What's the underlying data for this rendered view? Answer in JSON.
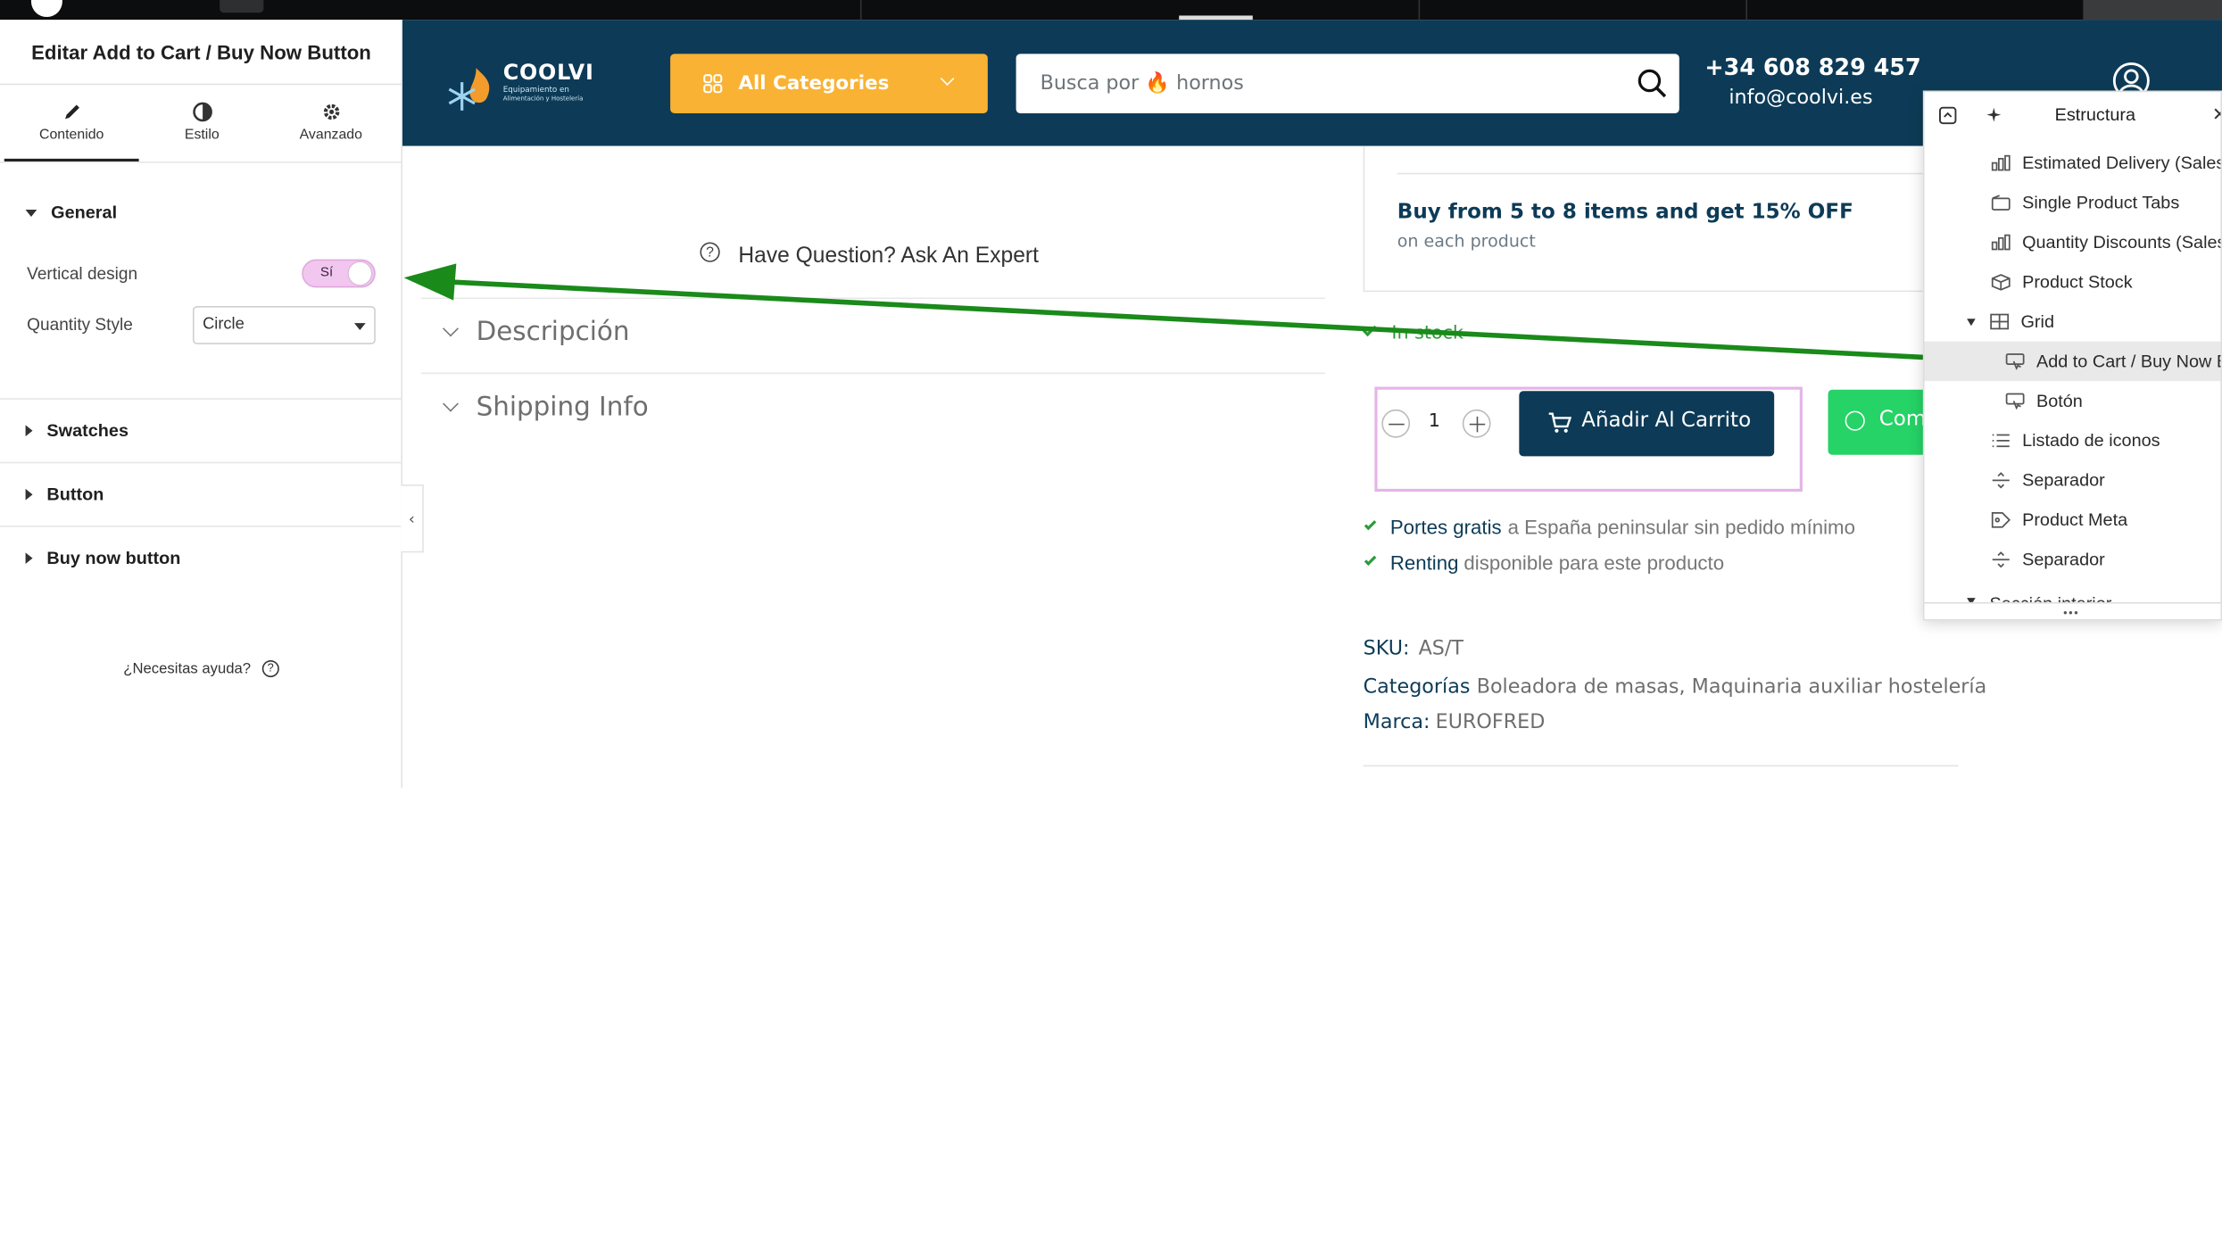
{
  "editor": {
    "title": "Editar Add to Cart / Buy Now Button",
    "tabs": [
      {
        "label": "Contenido",
        "icon": "pencil-icon",
        "active": true
      },
      {
        "label": "Estilo",
        "icon": "half-circle-icon",
        "active": false
      },
      {
        "label": "Avanzado",
        "icon": "gear-icon",
        "active": false
      }
    ],
    "general": {
      "heading": "General",
      "vertical_label": "Vertical design",
      "vertical_value": "Sí",
      "quantity_label": "Quantity Style",
      "quantity_value": "Circle"
    },
    "sections": [
      "Swatches",
      "Button",
      "Buy now button"
    ],
    "help": "¿Necesitas ayuda?"
  },
  "header": {
    "logo_name": "COOLVI",
    "logo_tagline_1": "Equipamiento en",
    "logo_tagline_2": "Alimentación y Hostelería",
    "categories_label": "All Categories",
    "search_placeholder": "Busca por 🔥 hornos",
    "phone": "+34 608 829 457",
    "email": "info@coolvi.es"
  },
  "product": {
    "ask_expert": "Have Question? Ask An Expert",
    "accordion": [
      "Descripción",
      "Shipping Info"
    ],
    "offer_title": "Buy from 5 to 8 items and get 15% OFF",
    "offer_sub": "on each product",
    "stock": "In stock",
    "qty": "1",
    "add_to_cart": "Añadir Al Carrito",
    "whatsapp_partial": "Com",
    "perks": [
      {
        "strong": "Portes gratis",
        "rest": "a España peninsular sin pedido mínimo"
      },
      {
        "strong": "Renting",
        "rest": "disponible para este producto"
      }
    ],
    "sku_label": "SKU:",
    "sku_value": "AS/T",
    "cat_label": "Categorías",
    "cat_value": "Boleadora de masas, Maquinaria auxiliar hostelería",
    "brand_label": "Marca:",
    "brand_value": "EUROFRED"
  },
  "structure": {
    "title": "Estructura",
    "items": [
      {
        "label": "Estimated Delivery (Sales",
        "icon": "chart-icon"
      },
      {
        "label": "Single Product Tabs",
        "icon": "tabs-icon"
      },
      {
        "label": "Quantity Discounts (Sales",
        "icon": "chart-icon"
      },
      {
        "label": "Product Stock",
        "icon": "box-icon"
      },
      {
        "label": "Grid",
        "icon": "grid-icon"
      },
      {
        "label": "Add to Cart / Buy Now B",
        "icon": "cart-button-icon"
      },
      {
        "label": "Botón",
        "icon": "button-icon"
      },
      {
        "label": "Listado de iconos",
        "icon": "list-icon"
      },
      {
        "label": "Separador",
        "icon": "divider-icon"
      },
      {
        "label": "Product Meta",
        "icon": "meta-icon"
      },
      {
        "label": "Separador",
        "icon": "divider-icon"
      },
      {
        "label": "Sección interior",
        "icon": "section-icon"
      }
    ]
  },
  "colors": {
    "header_bg": "#0d3b57",
    "categories_bg": "#f9b233",
    "cart_bg": "#0d3b57",
    "whatsapp_bg": "#25d366",
    "arrow": "#1a8a1a",
    "highlight": "#e5b4e8",
    "toggle_bg": "#f2c7ef"
  }
}
